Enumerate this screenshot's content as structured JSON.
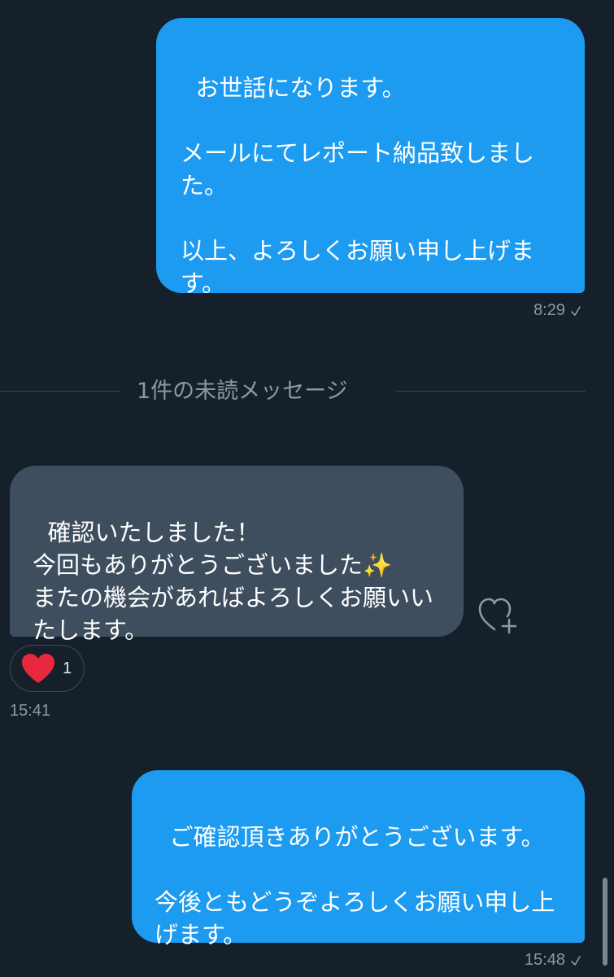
{
  "messages": [
    {
      "direction": "sent",
      "text": "お世話になります。\n\nメールにてレポート納品致しました。\n\n以上、よろしくお願い申し上げます。",
      "time": "8:29"
    },
    {
      "direction": "received",
      "text": "確認いたしました！\n今回もありがとうございました✨\nまたの機会があればよろしくお願いいたします。",
      "time": "15:41",
      "reaction": {
        "icon": "red-heart",
        "count": "1"
      }
    },
    {
      "direction": "sent",
      "text": "ご確認頂きありがとうございます。\n\n今後ともどうぞよろしくお願い申し上げます。",
      "time": "15:48"
    }
  ],
  "unread_divider": "1件の未読メッセージ",
  "colors": {
    "background": "#15202b",
    "sent_bubble": "#1d9bf0",
    "received_bubble": "#3f4e5e",
    "meta_text": "#8b98a5",
    "reaction_heart": "#e8283c"
  },
  "icons": {
    "read_check": "check-icon",
    "add_reaction": "heart-plus-icon"
  }
}
